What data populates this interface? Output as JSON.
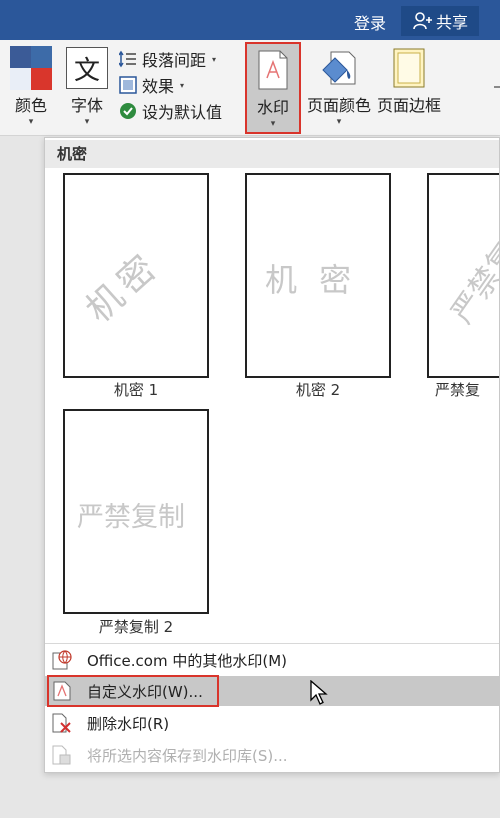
{
  "titlebar": {
    "login": "登录",
    "share": "共享"
  },
  "ribbon": {
    "colors_label": "颜色",
    "fonts_label": "字体",
    "paragraph_spacing": "段落间距",
    "effects": "效果",
    "set_default": "设为默认值",
    "watermark_label": "水印",
    "page_color_label": "页面颜色",
    "page_borders_label": "页面边框",
    "font_icon_glyph": "文",
    "caret": "▾"
  },
  "menu": {
    "section_title": "机密",
    "thumbnails": [
      {
        "label": "机密 1",
        "watermark": "机密"
      },
      {
        "label": "机密 2",
        "watermark": "机 密"
      },
      {
        "label": "严禁复",
        "watermark": "严禁复"
      },
      {
        "label": "严禁复制 2",
        "watermark": "严禁复制"
      }
    ],
    "items": [
      {
        "label": "Office.com 中的其他水印(M)",
        "disabled": false,
        "highlighted": false
      },
      {
        "label": "自定义水印(W)...",
        "disabled": false,
        "highlighted": true
      },
      {
        "label": "删除水印(R)",
        "disabled": false,
        "highlighted": false
      },
      {
        "label": "将所选内容保存到水印库(S)...",
        "disabled": true,
        "highlighted": false
      }
    ]
  },
  "colors": {
    "accent": "#2b579a",
    "highlight_border": "#d9342b"
  }
}
